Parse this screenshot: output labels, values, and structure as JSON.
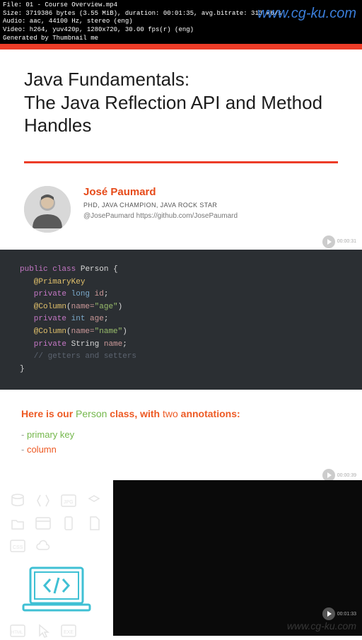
{
  "metadata": {
    "file": "File: 01 - Course Overview.mp4",
    "size": "Size: 3719386 bytes (3.55 MiB), duration: 00:01:35, avg.bitrate: 313 kb/s",
    "audio": "Audio: aac, 44100 Hz, stereo (eng)",
    "video": "Video: h264, yuv420p, 1280x720, 30.00 fps(r) (eng)",
    "gen": "Generated by Thumbnail me"
  },
  "watermark": "www.cg-ku.com",
  "title": "Java Fundamentals:\nThe Java Reflection API and Method Handles",
  "author": {
    "name": "José Paumard",
    "role": "PHD, JAVA CHAMPION, JAVA ROCK STAR",
    "handle": "@JosePaumard https://github.com/JosePaumard"
  },
  "timestamps": {
    "t1": "00:00:31",
    "t2": "00:00:39",
    "t3": "00:01:33"
  },
  "code": {
    "l1a": "public",
    "l1b": "class",
    "l1c": "Person",
    "l1d": "{",
    "l2": "   @PrimaryKey",
    "l3a": "   private",
    "l3b": "long",
    "l3c": "id",
    "l3d": ";",
    "l4a": "   @Column",
    "l4b": "(",
    "l4c": "name=",
    "l4d": "\"age\"",
    "l4e": ")",
    "l5a": "   private",
    "l5b": "int",
    "l5c": "age",
    "l5d": ";",
    "l6a": "   @Column",
    "l6b": "(",
    "l6c": "name=",
    "l6d": "\"name\"",
    "l6e": ")",
    "l7a": "   private",
    "l7b": "String",
    "l7c": "name",
    "l7d": ";",
    "l8": "",
    "l9": "   // getters and setters",
    "l10": "}"
  },
  "desc": {
    "lead1": "Here is our ",
    "lead2": "Person",
    "lead3": " class, with ",
    "lead4": "two",
    "lead5": " annotations:",
    "item1_dash": "- ",
    "item1": "primary key",
    "item2_dash": "- ",
    "item2": "column"
  }
}
